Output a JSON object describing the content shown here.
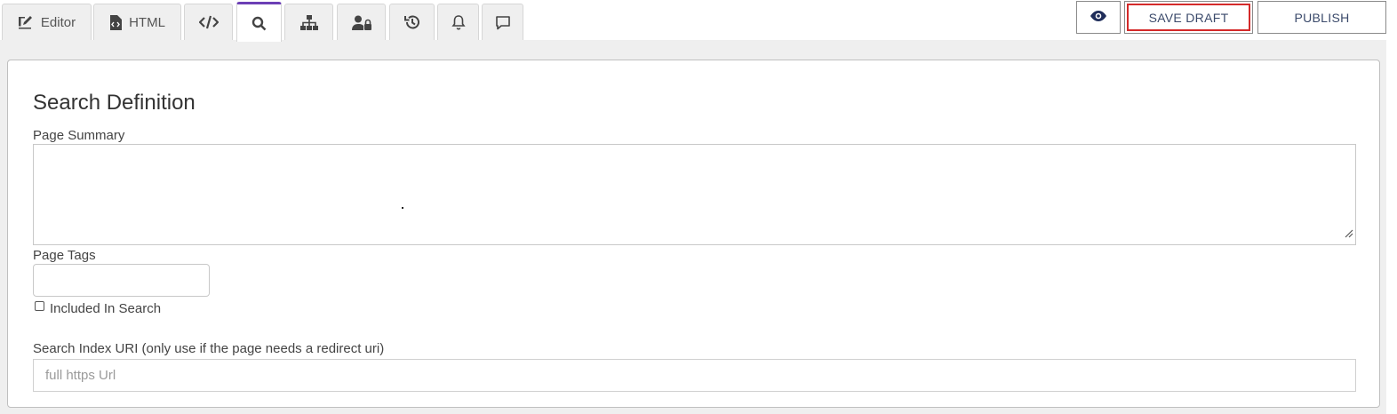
{
  "tabs": [
    {
      "label": "Editor",
      "icon": "edit-icon"
    },
    {
      "label": "HTML",
      "icon": "html-file-icon"
    },
    {
      "label": "",
      "icon": "code-icon"
    },
    {
      "label": "",
      "icon": "search-icon"
    },
    {
      "label": "",
      "icon": "sitemap-icon"
    },
    {
      "label": "",
      "icon": "user-lock-icon"
    },
    {
      "label": "",
      "icon": "history-icon"
    },
    {
      "label": "",
      "icon": "bell-icon"
    },
    {
      "label": "",
      "icon": "comment-icon"
    }
  ],
  "active_tab_icon": "search-icon",
  "actions": {
    "preview_icon": "eye-icon",
    "save_draft_label": "SAVE DRAFT",
    "publish_label": "PUBLISH"
  },
  "search_definition": {
    "title": "Search Definition",
    "page_summary_label": "Page Summary",
    "page_summary_value": "",
    "page_tags_label": "Page Tags",
    "page_tags_value": "",
    "included_in_search_label": "Included In Search",
    "included_in_search_checked": false,
    "uri_label": "Search Index URI (only use if the page needs a redirect uri)",
    "uri_placeholder": "full https Url",
    "uri_value": ""
  },
  "colors": {
    "active_tab_accent": "#6c3fb5",
    "save_draft_highlight": "#d42a2a",
    "button_text": "#3b4a6b"
  }
}
